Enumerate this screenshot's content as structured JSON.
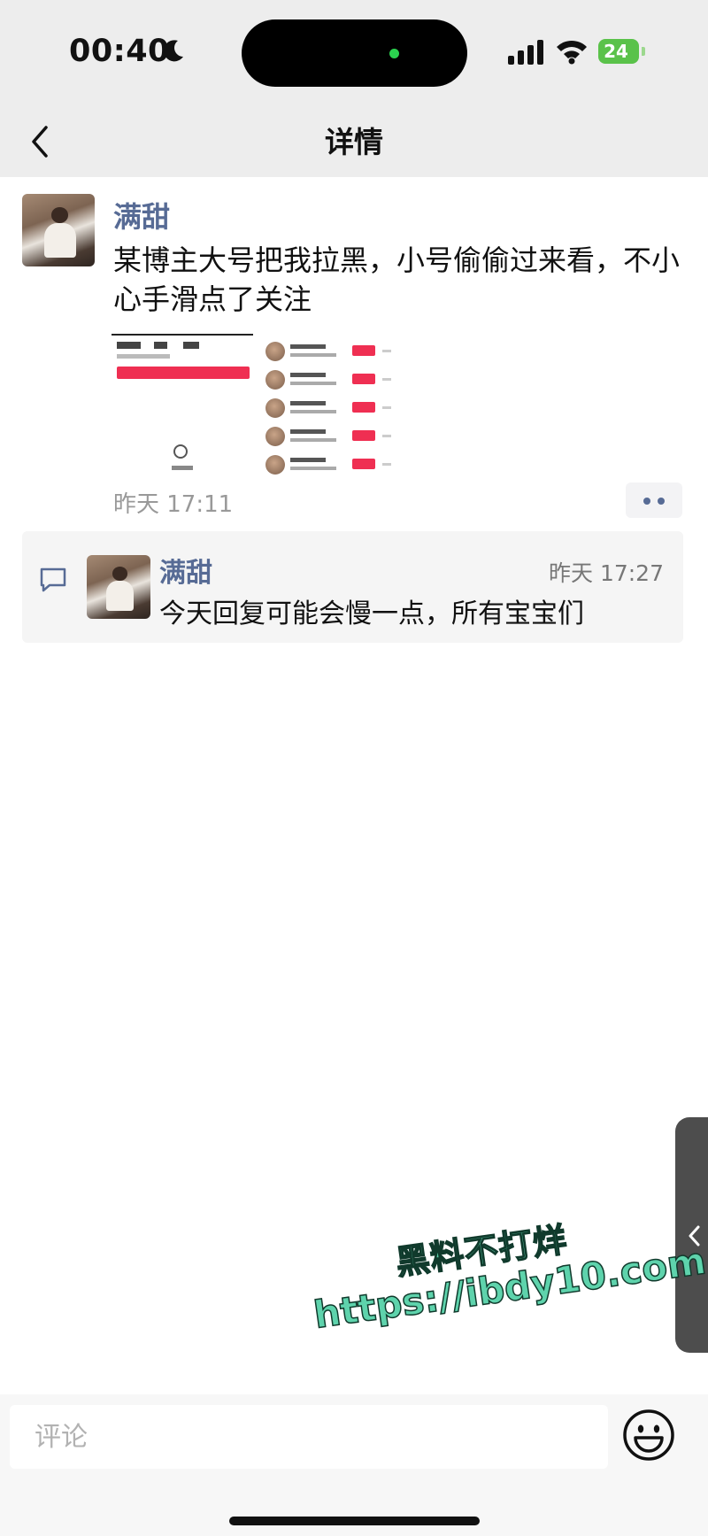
{
  "status_bar": {
    "time": "00:40",
    "battery": "24"
  },
  "header": {
    "title": "详情"
  },
  "post": {
    "author": "满甜",
    "text": "某博主大号把我拉黑，小号偷偷过来看，不小心手滑点了关注",
    "time": "昨天 17:11"
  },
  "comments": [
    {
      "author": "满甜",
      "time": "昨天 17:27",
      "text": "今天回复可能会慢一点，所有宝宝们"
    }
  ],
  "watermark": {
    "line1": "黑料不打烊",
    "line2": "https://ibdy10.com"
  },
  "comment_bar": {
    "placeholder": "评论"
  },
  "colors": {
    "name_blue": "#576b95",
    "battery_green": "#5ac24a",
    "watermark_green": "#5ed3ac"
  },
  "icons": [
    "moon-icon",
    "signal-icon",
    "wifi-icon",
    "battery-icon",
    "back-icon",
    "more-icon",
    "comment-icon",
    "chevron-left-icon",
    "emoji-icon"
  ]
}
